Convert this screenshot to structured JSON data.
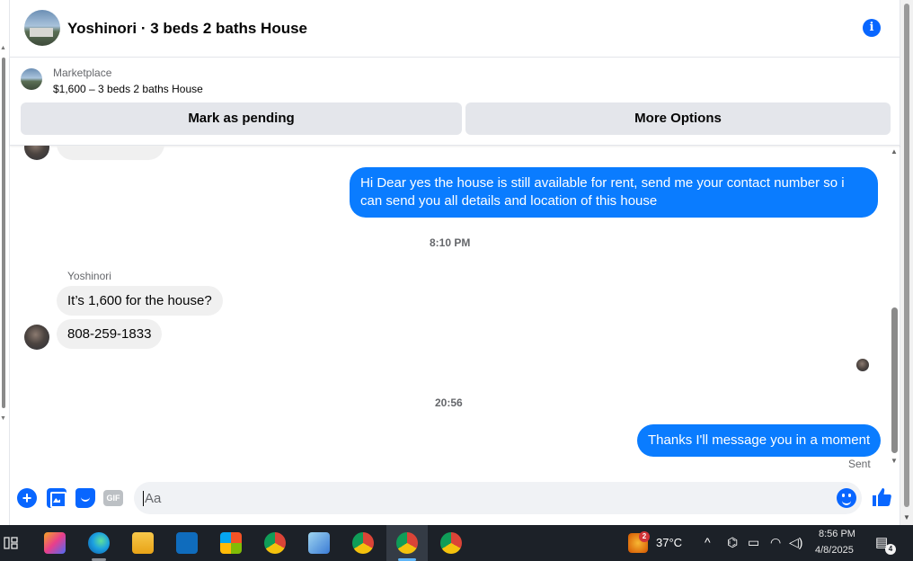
{
  "header": {
    "title": "Yoshinori · 3 beds 2 baths House",
    "info_icon": "info-icon"
  },
  "listing": {
    "label": "Marketplace",
    "price_title": "$1,600 – 3 beds 2 baths House",
    "mark_pending": "Mark as pending",
    "more_options": "More Options"
  },
  "messages": {
    "outgoing_1": "Hi Dear yes the house is still available for rent, send me your contact number so i can send you all details and location of this house",
    "time_1": "8:10 PM",
    "sender_name": "Yoshinori",
    "incoming_1": "It’s 1,600 for the house?",
    "incoming_2": "808-259-1833",
    "time_2": "20:56",
    "outgoing_2": "Thanks I'll message you in a moment",
    "sent_status": "Sent"
  },
  "composer": {
    "placeholder": "Aa",
    "gif_label": "GIF"
  },
  "taskbar": {
    "weather_badge": "2",
    "temperature": "37°C",
    "time": "8:56 PM",
    "date": "4/8/2025",
    "notification_count": "4"
  },
  "colors": {
    "accent": "#0866ff",
    "outgoing_bubble": "#0a7cff",
    "incoming_bubble": "#f0f0f0",
    "taskbar": "#1c2128"
  }
}
